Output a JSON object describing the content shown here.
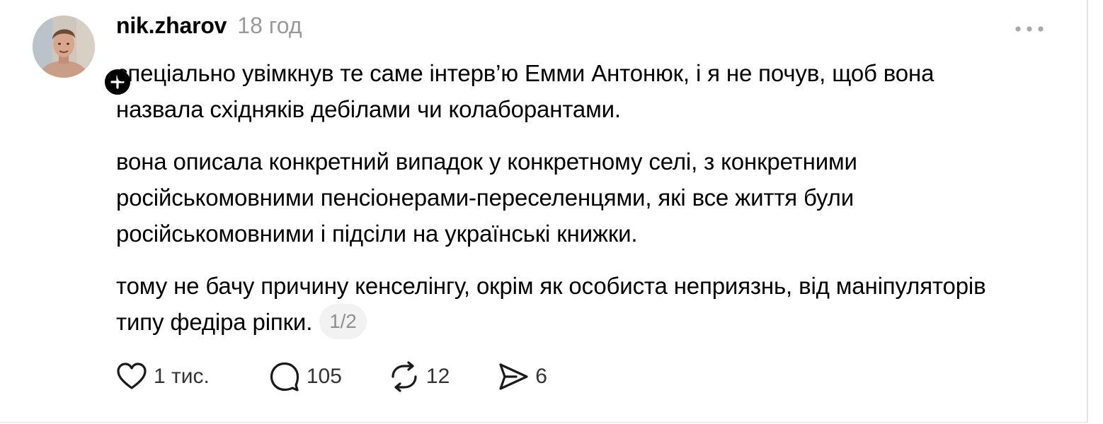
{
  "post": {
    "username": "nik.zharov",
    "timestamp": "18 год",
    "paragraphs": [
      "спеціально увімкнув те саме інтерв’ю Емми Антонюк, і я не почув, щоб вона назвала східняків дебілами чи колаборантами.",
      "вона описала конкретний випадок у конкретному селі, з конкретними російськомовними пенсіонерами-переселенцями, які все життя були російськомовними і підсіли на українські книжки.",
      "тому не бачу причину кенселінгу, окрім як особиста неприязнь, від маніпуляторів типу федіра ріпки."
    ],
    "pager": "1/2"
  },
  "actions": {
    "likes": "1 тис.",
    "replies": "105",
    "reposts": "12",
    "shares": "6"
  },
  "icons": {
    "avatar": "avatar",
    "follow": "plus-icon",
    "more": "more-horizontal-icon",
    "like": "heart-icon",
    "reply": "comment-icon",
    "repost": "repost-icon",
    "share": "send-icon"
  },
  "colors": {
    "text": "#000000",
    "muted": "#9a9a9a",
    "pager_bg": "#f2f2f2"
  }
}
